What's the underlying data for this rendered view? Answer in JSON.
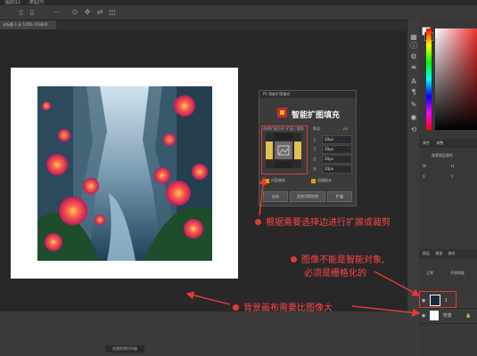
{
  "app": {
    "menu_items": [
      "图层(L)",
      "类型(Y)"
    ],
    "document_tab": "未标题-1 @ 100% (RGB/8)"
  },
  "dialog": {
    "title": "PS 智能扩图填充",
    "heading": "智能扩图填充",
    "mode_label": "选择扩展方向",
    "mode_value": "扩展 / 裁剪",
    "size_label": "数值",
    "size_unit": "px",
    "fields": [
      {
        "label": "上",
        "value": "20px"
      },
      {
        "label": "下",
        "value": "20px"
      },
      {
        "label": "左",
        "value": "20px"
      },
      {
        "label": "右",
        "value": "20px"
      }
    ],
    "checkbox_1": "内容感知",
    "checkbox_2": "创建副本",
    "buttons": [
      "自动",
      "适合可用空间",
      "扩展"
    ]
  },
  "annotations": {
    "a1": "根据需要选择边进行扩展或裁剪",
    "a2_line1": "图像不能是智能对象,",
    "a2_line2": "必须是栅格化的",
    "a3": "背景画布需要比图像大"
  },
  "properties": {
    "tab1": "属性",
    "tab2": "调整",
    "row1": "像素图层属性",
    "w_label": "W",
    "h_label": "H",
    "x_label": "X",
    "y_label": "Y"
  },
  "layers": {
    "tab1": "图层",
    "tab2": "通道",
    "tab3": "路径",
    "blend": "正常",
    "opacity": "不透明度",
    "layer1": "1",
    "layer2": "背景"
  },
  "status": {
    "timeline": "创建视频时间轴"
  },
  "colors": {
    "accent_red": "#e53935",
    "accent_yellow": "#f0c420",
    "panel_bg": "#3b3b3b"
  },
  "icons": [
    "move-icon",
    "marquee-icon",
    "lasso-icon",
    "info-icon",
    "adjust-icon",
    "text-icon",
    "paragraph-icon",
    "brush-settings-icon",
    "color-wheel-icon",
    "eye-icon",
    "lock-icon"
  ]
}
